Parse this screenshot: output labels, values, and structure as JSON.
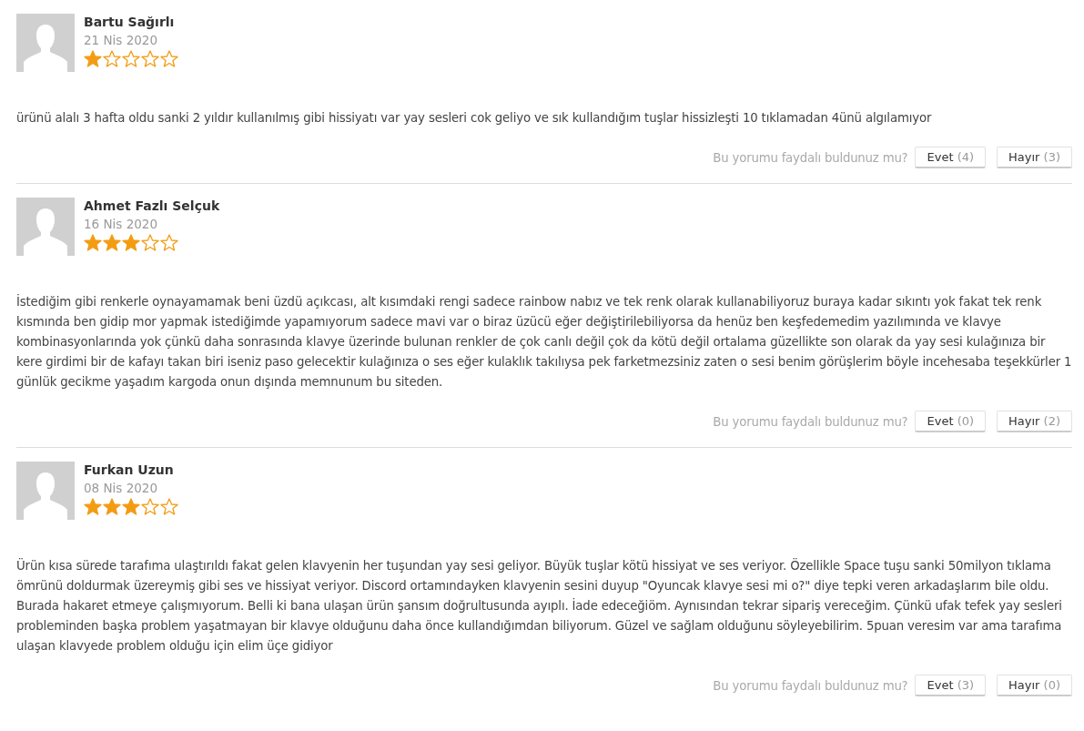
{
  "reviews": [
    {
      "author": "Bartu Sağırlı",
      "date": "21 Nis 2020",
      "stars": 1,
      "text": "ürünü alalı 3 hafta oldu sanki 2 yıldır kullanılmış gibi hissiyatı var yay sesleri cok geliyo ve sık kullandığım tuşlar hissizleşti 10 tıklamadan 4ünü algılamıyor",
      "prompt": "Bu yorumu faydalı buldunuz mu?",
      "buttons": [
        {
          "label": "Evet",
          "count": "(4)"
        },
        {
          "label": "Hayır",
          "count": "(3)"
        }
      ]
    },
    {
      "author": "Ahmet Fazlı Selçuk",
      "date": "16 Nis 2020",
      "stars": 3,
      "text": "İstediğim gibi renkerle oynayamamak beni üzdü açıkcası, alt kısımdaki rengi sadece rainbow nabız ve tek renk olarak kullanabiliyoruz buraya kadar sıkıntı yok fakat tek renk kısmında ben gidip mor yapmak istediğimde yapamıyorum sadece mavi var o biraz üzücü eğer değiştirilebiliyorsa da henüz ben keşfedemedim yazılımında ve klavye kombinasyonlarında yok çünkü daha sonrasında klavye üzerinde bulunan renkler de çok canlı değil çok da kötü değil ortalama güzellikte son olarak da yay sesi kulağınıza bir kere girdimi bir de kafayı takan biri iseniz paso gelecektir kulağınıza o ses eğer kulaklık takılıysa pek farketmezsiniz zaten o sesi benim görüşlerim böyle incehesaba teşekkürler 1 günlük gecikme yaşadım kargoda onun dışında memnunum bu siteden.",
      "prompt": "Bu yorumu faydalı buldunuz mu?",
      "buttons": [
        {
          "label": "Evet",
          "count": "(0)"
        },
        {
          "label": "Hayır",
          "count": "(2)"
        }
      ]
    },
    {
      "author": "Furkan Uzun",
      "date": "08 Nis 2020",
      "stars": 3,
      "text": "Ürün kısa sürede tarafıma ulaştırıldı fakat gelen klavyenin her tuşundan yay sesi geliyor. Büyük tuşlar kötü hissiyat ve ses veriyor. Özellikle Space tuşu sanki 50milyon tıklama ömrünü doldurmak üzereymiş gibi ses ve hissiyat veriyor. Discord ortamındayken klavyenin sesini duyup \"Oyuncak klavye sesi mi o?\" diye tepki veren arkadaşlarım bile oldu. Burada hakaret etmeye çalışmıyorum. Belli ki bana ulaşan ürün şansım doğrultusunda ayıplı. İade edeceğiöm. Aynısından tekrar sipariş vereceğim. Çünkü ufak tefek yay sesleri probleminden başka problem yaşatmayan bir klavye olduğunu daha önce kullandığımdan biliyorum. Güzel ve sağlam olduğunu söyleyebilirim. 5puan veresim var ama tarafıma ulaşan klavyede problem olduğu için elim üçe gidiyor",
      "prompt": "Bu yorumu faydalı buldunuz mu?",
      "buttons": [
        {
          "label": "Evet",
          "count": "(3)"
        },
        {
          "label": "Hayır",
          "count": "(0)"
        }
      ]
    }
  ]
}
